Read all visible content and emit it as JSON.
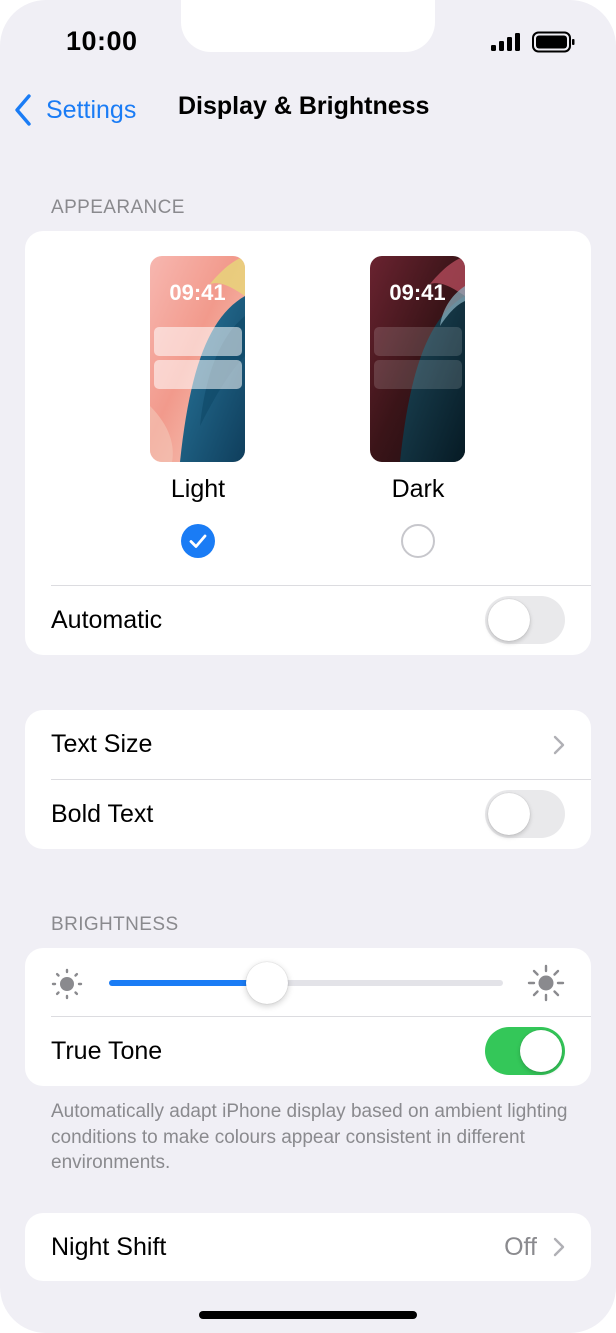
{
  "status_bar": {
    "time": "10:00",
    "signal_icon": "cellular-signal-icon",
    "battery_icon": "battery-icon"
  },
  "nav": {
    "back_label": "Settings",
    "title": "Display & Brightness"
  },
  "appearance": {
    "header": "APPEARANCE",
    "preview_time": "09:41",
    "light_label": "Light",
    "dark_label": "Dark",
    "selected": "Light",
    "automatic_label": "Automatic",
    "automatic_on": false
  },
  "text_section": {
    "text_size_label": "Text Size",
    "bold_text_label": "Bold Text",
    "bold_text_on": false
  },
  "brightness": {
    "header": "BRIGHTNESS",
    "level": 0.4,
    "true_tone_label": "True Tone",
    "true_tone_on": true,
    "footnote": "Automatically adapt iPhone display based on ambient lighting conditions to make colours appear consistent in different environments."
  },
  "night_shift": {
    "label": "Night Shift",
    "value": "Off"
  },
  "colors": {
    "accent": "#1a7cf5",
    "toggle_on": "#34c759",
    "toggle_off": "#e9e9eb",
    "background": "#f0eff5",
    "secondary_text": "#8a8a8e"
  }
}
